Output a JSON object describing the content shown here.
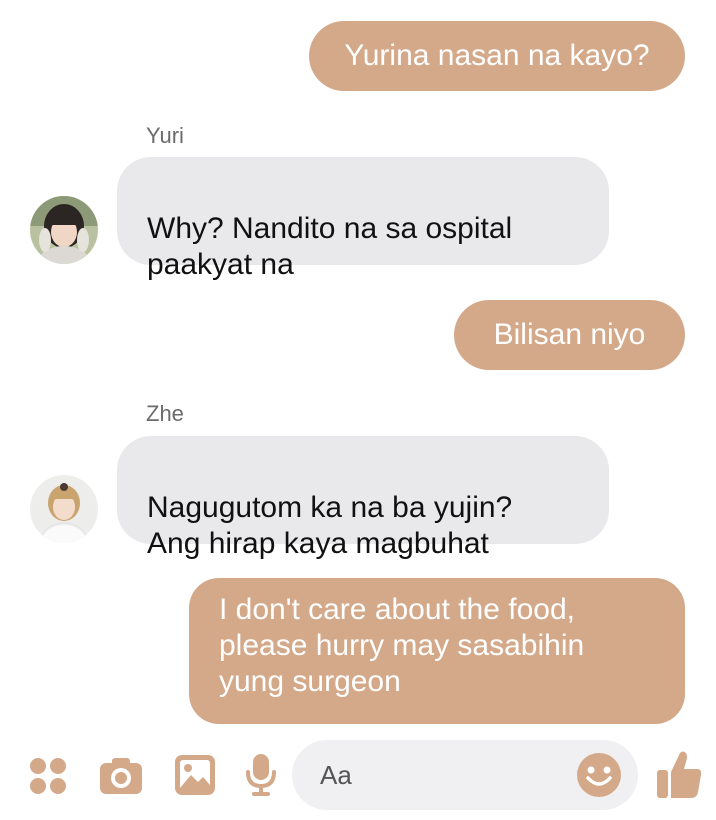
{
  "conversation": {
    "messages": [
      {
        "direction": "outgoing",
        "text": "Yurina nasan na kayo?"
      },
      {
        "direction": "incoming",
        "sender": "Yuri",
        "text": "Why? Nandito na sa ospital\npaakyat na"
      },
      {
        "direction": "outgoing",
        "text": "Bilisan niyo"
      },
      {
        "direction": "incoming",
        "sender": "Zhe",
        "text": "Nagugutom ka na ba yujin?\nAng hirap kaya magbuhat"
      },
      {
        "direction": "outgoing",
        "text": "I don't care about the food,\nplease hurry may sasabihin\nyung surgeon"
      }
    ]
  },
  "composer": {
    "placeholder": "Aa",
    "icons": [
      "menu-dots-icon",
      "camera-icon",
      "image-icon",
      "microphone-icon",
      "emoji-icon",
      "thumbs-up-icon"
    ]
  },
  "colors": {
    "outgoing_bubble": "#d4a98a",
    "incoming_bubble": "#e9e9eb",
    "accent": "#d4a98a"
  }
}
